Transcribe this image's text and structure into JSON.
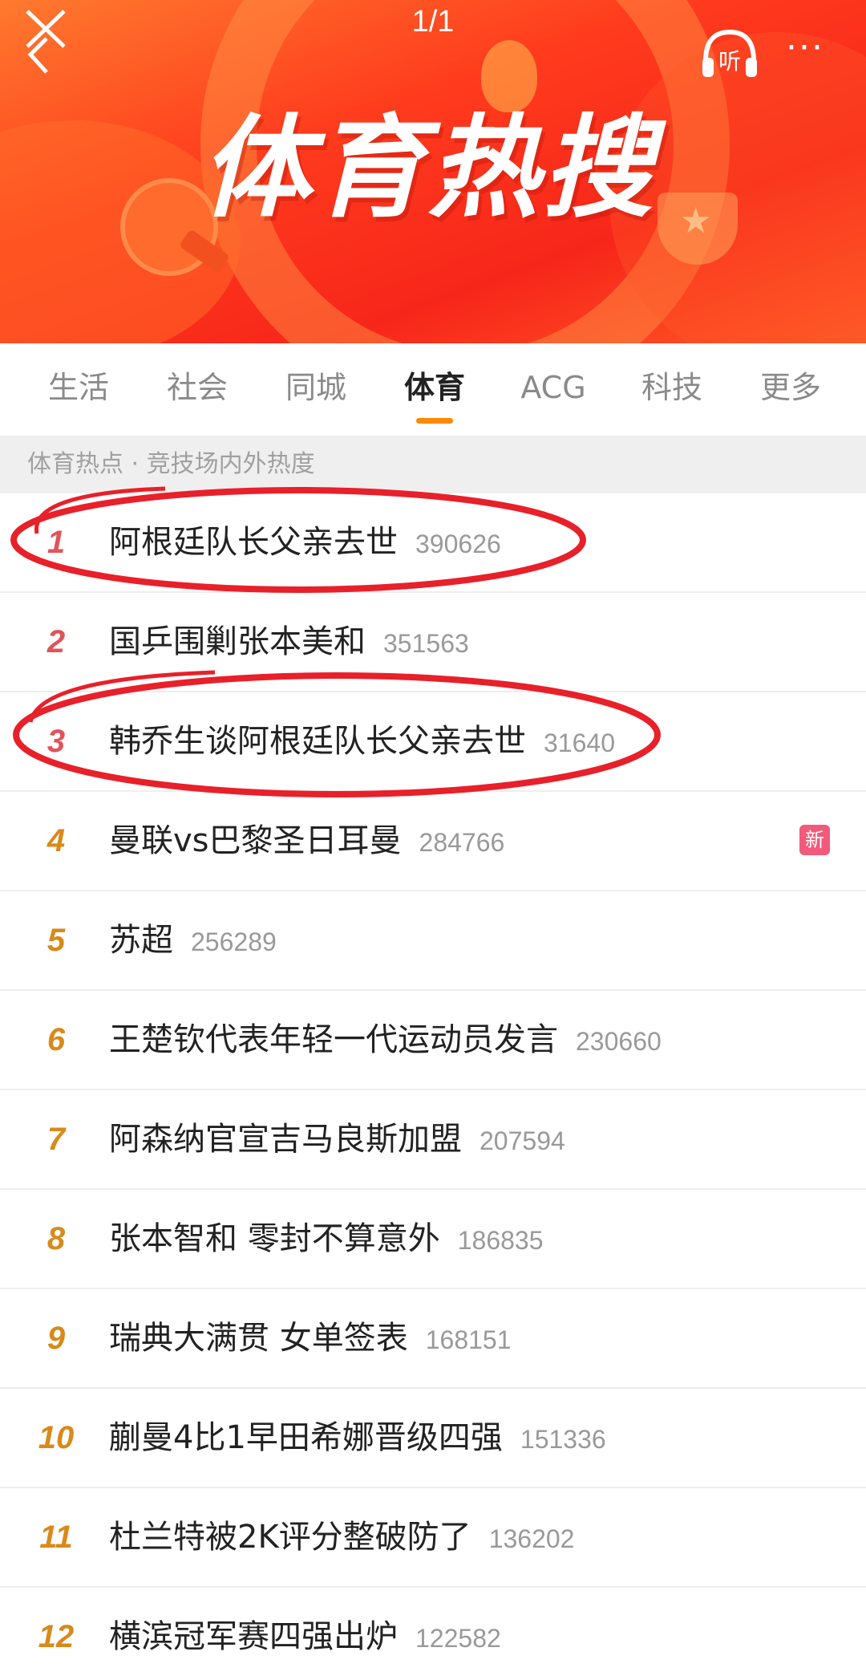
{
  "header": {
    "page_indicator": "1/1",
    "title": "体育热搜",
    "listen_label": "听",
    "more_label": "···"
  },
  "tabs": [
    {
      "label": "生活",
      "active": false
    },
    {
      "label": "社会",
      "active": false
    },
    {
      "label": "同城",
      "active": false
    },
    {
      "label": "体育",
      "active": true
    },
    {
      "label": "ACG",
      "active": false
    },
    {
      "label": "科技",
      "active": false
    },
    {
      "label": "更多",
      "active": false
    }
  ],
  "subheader": "体育热点 · 竞技场内外热度",
  "items": [
    {
      "rank": "1",
      "title": "阿根廷队长父亲去世",
      "count": "390626",
      "badge": ""
    },
    {
      "rank": "2",
      "title": "国乒围剿张本美和",
      "count": "351563",
      "badge": ""
    },
    {
      "rank": "3",
      "title": "韩乔生谈阿根廷队长父亲去世",
      "count": "31640",
      "badge": ""
    },
    {
      "rank": "4",
      "title": "曼联vs巴黎圣日耳曼",
      "count": "284766",
      "badge": "新"
    },
    {
      "rank": "5",
      "title": "苏超",
      "count": "256289",
      "badge": ""
    },
    {
      "rank": "6",
      "title": "王楚钦代表年轻一代运动员发言",
      "count": "230660",
      "badge": ""
    },
    {
      "rank": "7",
      "title": "阿森纳官宣吉马良斯加盟",
      "count": "207594",
      "badge": ""
    },
    {
      "rank": "8",
      "title": "张本智和 零封不算意外",
      "count": "186835",
      "badge": ""
    },
    {
      "rank": "9",
      "title": "瑞典大满贯 女单签表",
      "count": "168151",
      "badge": ""
    },
    {
      "rank": "10",
      "title": "蒯曼4比1早田希娜晋级四强",
      "count": "151336",
      "badge": ""
    },
    {
      "rank": "11",
      "title": "杜兰特被2K评分整破防了",
      "count": "136202",
      "badge": ""
    },
    {
      "rank": "12",
      "title": "横滨冠军赛四强出炉",
      "count": "122582",
      "badge": ""
    }
  ],
  "colors": {
    "banner": "#f7261a",
    "tab_accent": "#ff8a00",
    "rank_top": "#e0545a",
    "rank_normal": "#d88a1a",
    "badge_new": "#f25a7b",
    "annotation": "#e8202a"
  }
}
